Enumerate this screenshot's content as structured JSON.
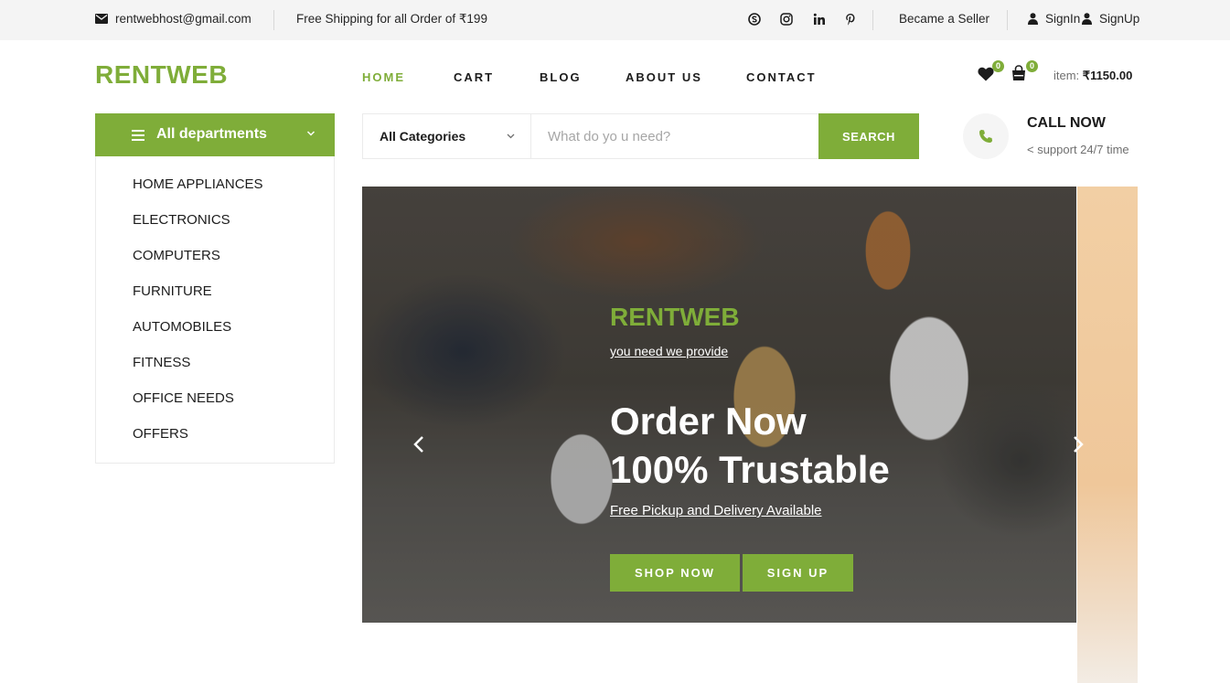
{
  "topbar": {
    "email": "rentwebhost@gmail.com",
    "shipping": "Free Shipping for all Order of ₹199",
    "socials": [
      "skype-icon",
      "instagram-icon",
      "linkedin-icon",
      "pinterest-icon"
    ],
    "seller": "Became a Seller",
    "signin": "SignIn",
    "signup": "SignUp"
  },
  "header": {
    "logo": "RENTWEB",
    "nav": [
      "HOME",
      "CART",
      "BLOG",
      "ABOUT US",
      "CONTACT"
    ],
    "active_nav": "HOME",
    "wishlist_count": "0",
    "cart_count": "0",
    "item_label": "item: ",
    "item_total": "₹1150.00"
  },
  "departments": {
    "title": "All departments",
    "items": [
      "HOME APPLIANCES",
      "ELECTRONICS",
      "COMPUTERS",
      "FURNITURE",
      "AUTOMOBILES",
      "FITNESS",
      "OFFICE NEEDS",
      "OFFERS"
    ]
  },
  "search": {
    "category": "All Categories",
    "placeholder": "What do yo u need?",
    "button": "SEARCH"
  },
  "call": {
    "title": "CALL NOW",
    "subtitle": "< support 24/7 time"
  },
  "hero": {
    "brand": "RENTWEB",
    "tagline": "you need we provide",
    "headline_1": "Order Now",
    "headline_2": "100% Trustable",
    "subline": "Free Pickup and Delivery Available",
    "shop_button": "SHOP NOW",
    "signup_button": "SIGN UP"
  },
  "colors": {
    "accent": "#7fad39",
    "topbar_bg": "#f4f4f4",
    "text": "#1c1c1c"
  }
}
